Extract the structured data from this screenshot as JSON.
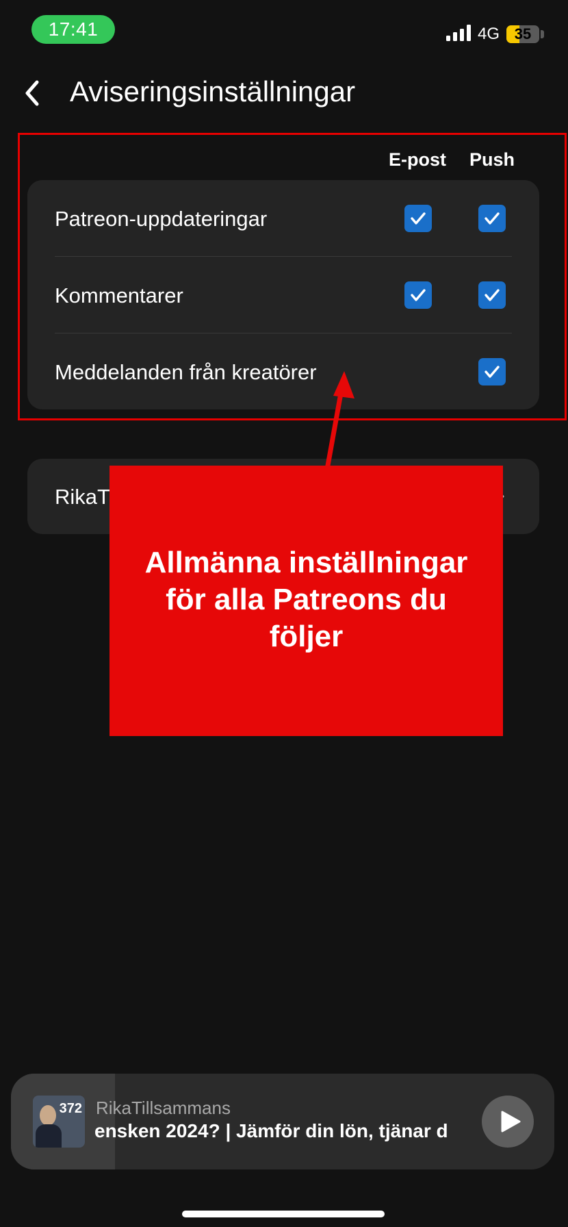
{
  "status_bar": {
    "time": "17:41",
    "network": "4G",
    "battery": "35",
    "battery_level_percent": 35,
    "signal_bars": 4
  },
  "header": {
    "title": "Aviseringsinställningar",
    "back_icon": "chevron-left-icon"
  },
  "settings": {
    "columns": {
      "email": "E-post",
      "push": "Push"
    },
    "rows": [
      {
        "label": "Patreon-uppdateringar",
        "email": true,
        "push": true
      },
      {
        "label": "Kommentarer",
        "email": true,
        "push": true
      },
      {
        "label": "Meddelanden från kreatörer",
        "email": null,
        "push": true
      }
    ]
  },
  "creator_row": {
    "label": "RikaTi"
  },
  "annotation": {
    "text": "Allmänna inställningar för alla Patreons du följer",
    "color": "#e60808"
  },
  "player": {
    "thumbnail_number": "372",
    "creator": "RikaTillsammans",
    "episode": "ensken 2024? | Jämför din lön, tjänar d",
    "play_icon": "play-icon"
  },
  "colors": {
    "background": "#121212",
    "card": "#242424",
    "checkbox": "#1a6fc9",
    "status_pill": "#34c759",
    "highlight": "#e60000"
  }
}
